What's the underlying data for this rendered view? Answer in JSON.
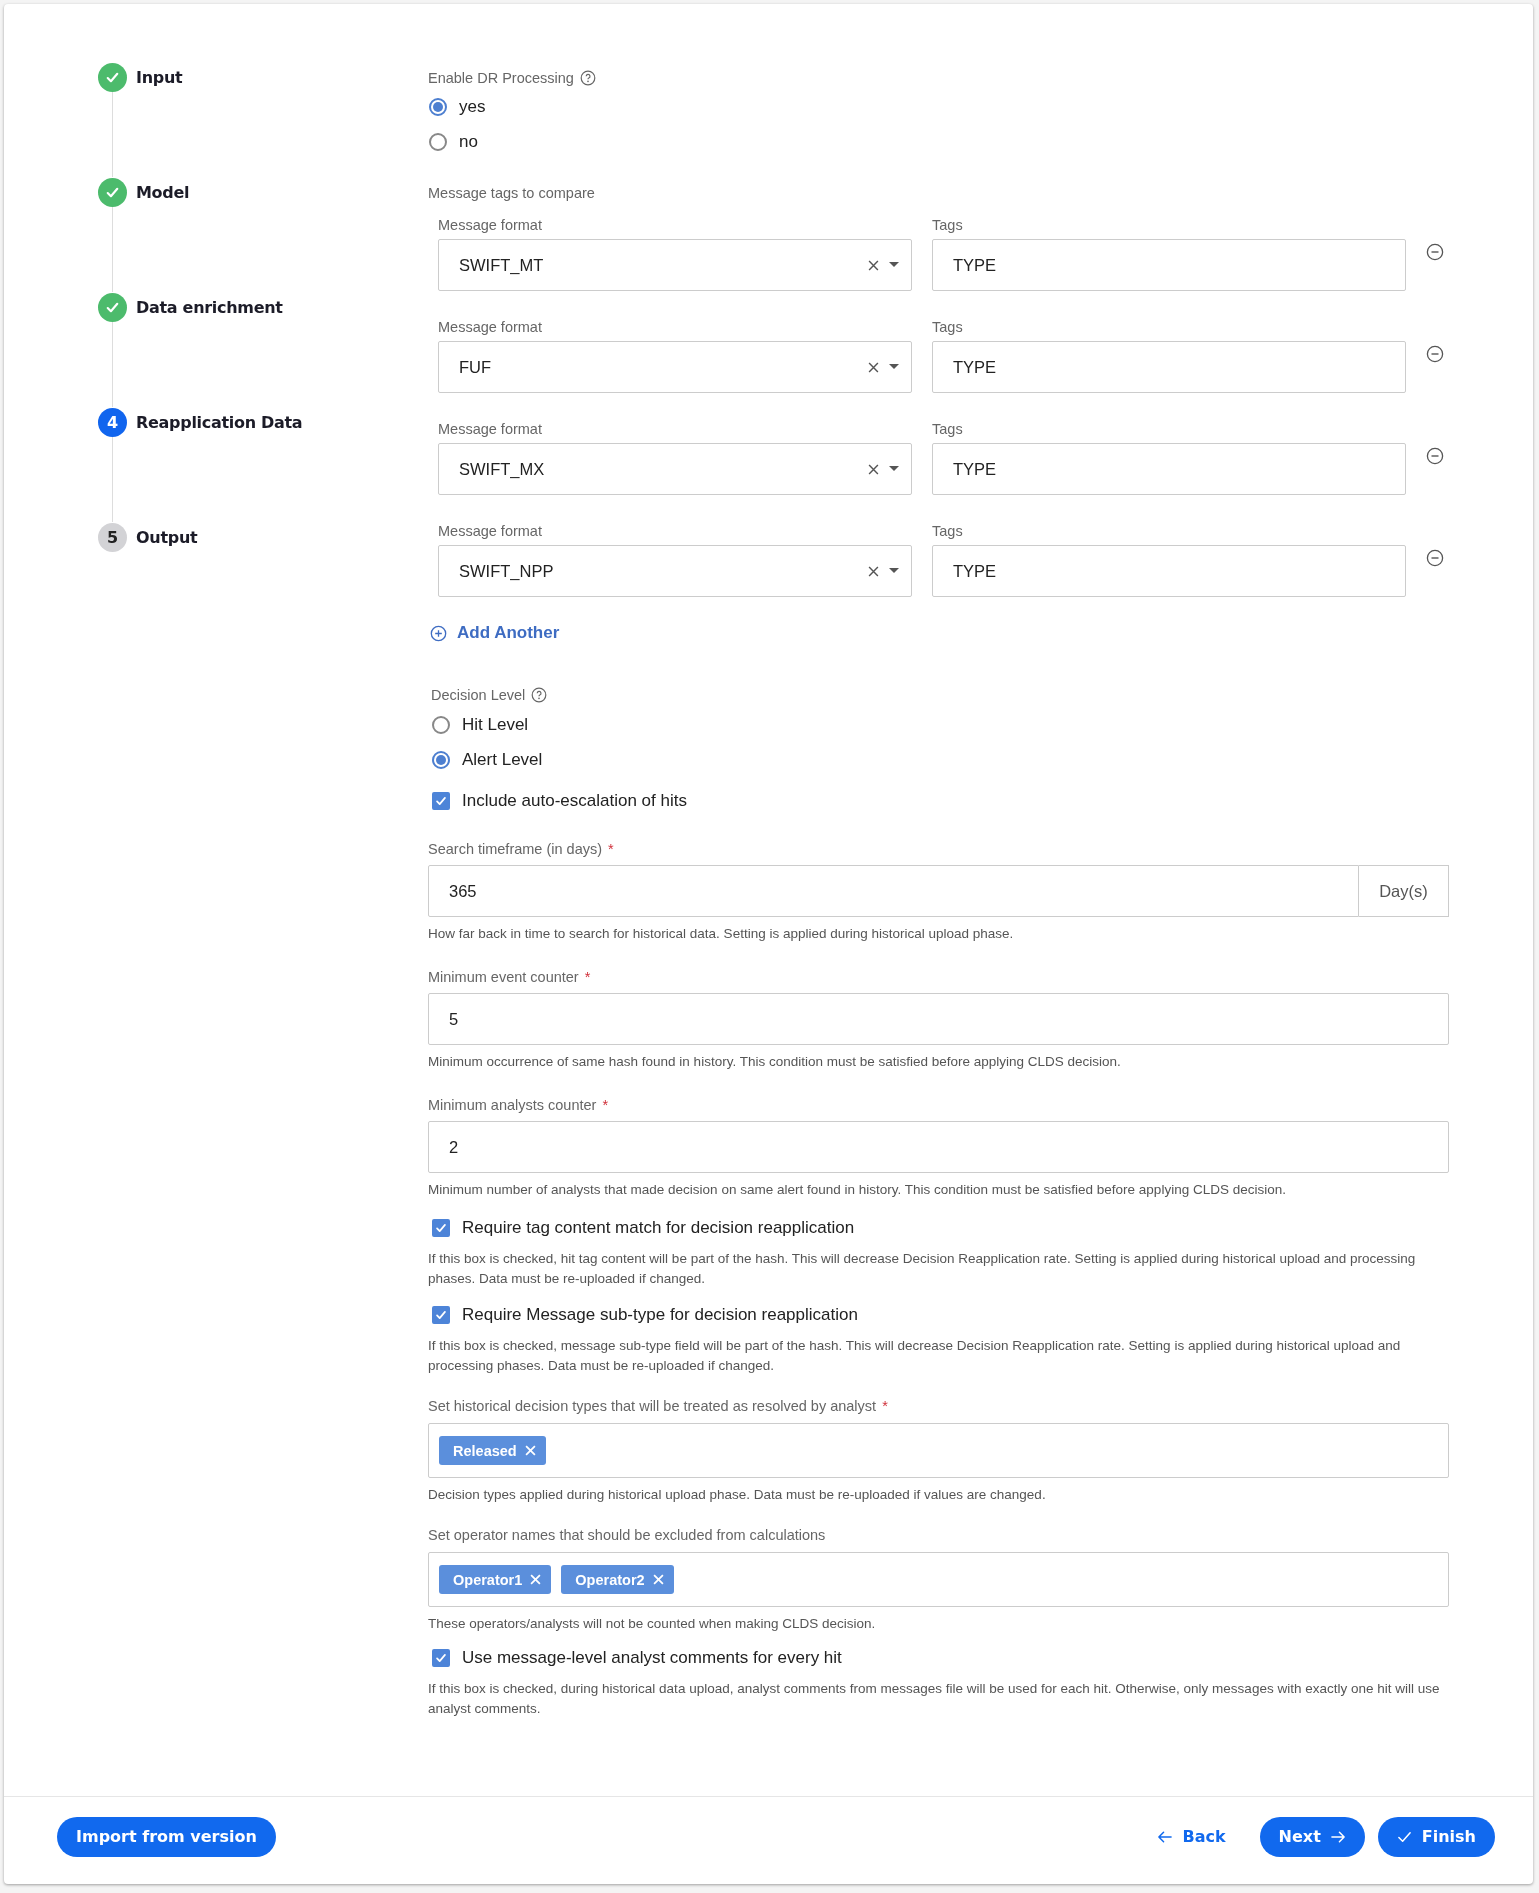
{
  "stepper": {
    "steps": [
      {
        "label": "Input",
        "kind": "done"
      },
      {
        "label": "Model",
        "kind": "done"
      },
      {
        "label": "Data enrichment",
        "kind": "done"
      },
      {
        "label": "Reapplication Data",
        "kind": "current",
        "number": "4"
      },
      {
        "label": "Output",
        "kind": "pending",
        "number": "5"
      }
    ]
  },
  "dr_processing": {
    "label": "Enable DR Processing",
    "info_icon": true,
    "options": [
      {
        "label": "yes",
        "selected": true
      },
      {
        "label": "no",
        "selected": false
      }
    ]
  },
  "message_tags": {
    "label": "Message tags to compare",
    "rows": [
      {
        "format_label": "Message format",
        "format_value": "SWIFT_MT",
        "tags_label": "Tags",
        "tags_value": "TYPE"
      },
      {
        "format_label": "Message format",
        "format_value": "FUF",
        "tags_label": "Tags",
        "tags_value": "TYPE"
      },
      {
        "format_label": "Message format",
        "format_value": "SWIFT_MX",
        "tags_label": "Tags",
        "tags_value": "TYPE"
      },
      {
        "format_label": "Message format",
        "format_value": "SWIFT_NPP",
        "tags_label": "Tags",
        "tags_value": "TYPE"
      }
    ],
    "add_button": "Add Another"
  },
  "decision_level": {
    "label": "Decision Level",
    "info_icon": true,
    "options": [
      {
        "label": "Hit Level",
        "selected": false
      },
      {
        "label": "Alert Level",
        "selected": true
      }
    ]
  },
  "auto_escalation": {
    "label": "Include auto-escalation of hits",
    "checked": true
  },
  "search_timeframe": {
    "label": "Search timeframe (in days)",
    "required_mark": "*",
    "value": "365",
    "unit": "Day(s)",
    "help": "How far back in time to search for historical data. Setting is applied during historical upload phase."
  },
  "min_event_counter": {
    "label": "Minimum event counter",
    "required_mark": "*",
    "value": "5",
    "help": "Minimum occurrence of same hash found in history. This condition must be satisfied before applying CLDS decision."
  },
  "min_analysts_counter": {
    "label": "Minimum analysts counter",
    "required_mark": "*",
    "value": "2",
    "help": "Minimum number of analysts that made decision on same alert found in history. This condition must be satisfied before applying CLDS decision."
  },
  "require_tag_match": {
    "label": "Require tag content match for decision reapplication",
    "checked": true,
    "help": "If this box is checked, hit tag content will be part of the hash. This will decrease Decision Reapplication rate. Setting is applied during historical upload and processing phases. Data must be re-uploaded if changed."
  },
  "require_subtype": {
    "label": "Require Message sub-type for decision reapplication",
    "checked": true,
    "help": "If this box is checked, message sub-type field will be part of the hash. This will decrease Decision Reapplication rate. Setting is applied during historical upload and processing phases. Data must be re-uploaded if changed."
  },
  "resolved_decision_types": {
    "label": "Set historical decision types that will be treated as resolved by analyst",
    "required_mark": "*",
    "chips": [
      "Released"
    ],
    "help": "Decision types applied during historical upload phase. Data must be re-uploaded if values are changed."
  },
  "excluded_operators": {
    "label": "Set operator names that should be excluded from calculations",
    "chips": [
      "Operator1",
      "Operator2"
    ],
    "help": "These operators/analysts will not be counted when making CLDS decision."
  },
  "message_level_comments": {
    "label": "Use message-level analyst comments for every hit",
    "checked": true,
    "help": "If this box is checked, during historical data upload, analyst comments from messages file will be used for each hit. Otherwise, only messages with exactly one hit will use analyst comments."
  },
  "footer": {
    "import_button": "Import from version",
    "back_button": "Back",
    "next_button": "Next",
    "finish_button": "Finish"
  }
}
